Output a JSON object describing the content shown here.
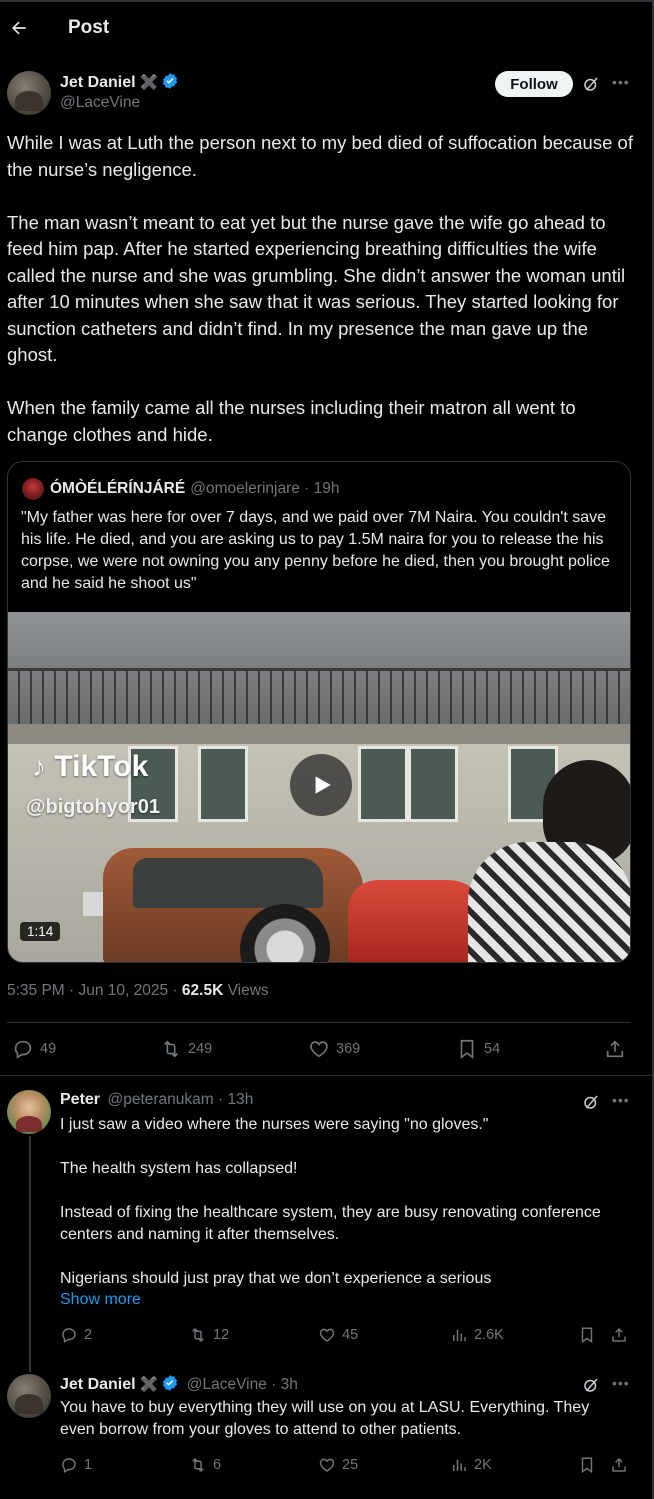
{
  "header": {
    "title": "Post"
  },
  "post": {
    "name": "Jet Daniel",
    "name_emoji": "✖️",
    "handle": "@LaceVine",
    "follow_label": "Follow",
    "text": "While I was at Luth the person next to my bed died of suffocation because of the nurse’s negligence.\n\nThe man wasn’t meant to eat yet but the nurse gave the wife go ahead to feed him pap. After he started experiencing breathing difficulties the wife called the nurse and she was grumbling. She didn’t answer the woman until after 10 minutes when she saw that it was serious. They started looking for sunction catheters and didn’t find. In my presence the man gave up the ghost.\n\nWhen the family came all the nurses including their matron all went to change clothes and hide.",
    "time": "5:35 PM · Jun 10, 2025 · ",
    "views_count": "62.5K",
    "views_label": " Views",
    "stats": {
      "replies": "49",
      "reposts": "249",
      "likes": "369",
      "bookmarks": "54"
    }
  },
  "quote": {
    "name": "ÓMÒÉLÉRÍNJÁRÉ",
    "handle_time": "@omoelerinjare · 19h",
    "text": "\"My father was here for over 7 days, and we paid over 7M Naira. You couldn't save his life. He died, and you are asking us to pay 1.5M naira for you to release the his corpse, we were not owning you any penny before he died, then you brought police and he said he shoot us\"",
    "video": {
      "watermark": "TikTok",
      "watermark_handle": "@bigtohyor01",
      "duration": "1:14"
    }
  },
  "replies": [
    {
      "name": "Peter",
      "handle_time": "@peteranukam · 13h",
      "text": "I just saw a video where the nurses were saying \"no gloves.\"\n\nThe health system has collapsed!\n\nInstead of fixing the healthcare system, they are busy renovating conference centers and naming it after themselves.\n\nNigerians should just pray that we don’t experience a serious",
      "show_more": "Show more",
      "stats": {
        "replies": "2",
        "reposts": "12",
        "likes": "45",
        "views": "2.6K"
      }
    },
    {
      "name": "Jet Daniel",
      "name_emoji": "✖️",
      "handle_time": "@LaceVine · 3h",
      "text": "You have to buy everything they will use on you at LASU. Everything. They even borrow from your gloves to attend to other patients.",
      "stats": {
        "replies": "1",
        "reposts": "6",
        "likes": "25",
        "views": "2K"
      }
    }
  ],
  "colors": {
    "accent": "#1d9bf0",
    "muted": "#71767b",
    "text": "#e7e9ea",
    "background": "#000000"
  }
}
